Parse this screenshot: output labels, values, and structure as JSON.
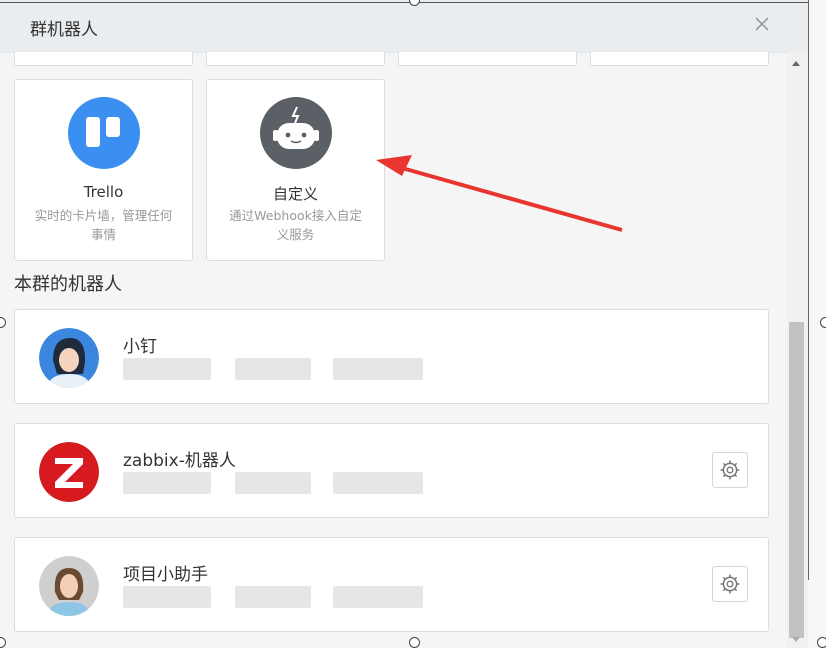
{
  "dialog": {
    "title": "群机器人"
  },
  "integrations": [
    {
      "name": "Trello",
      "desc": "实时的卡片墙，管理任何事情",
      "icon": "trello-icon",
      "color": "#3a8ff0"
    },
    {
      "name": "自定义",
      "desc": "通过Webhook接入自定义服务",
      "icon": "robot-icon",
      "color": "#5b6066"
    }
  ],
  "section": {
    "title": "本群的机器人"
  },
  "robots": [
    {
      "name": "小钉",
      "avatar": "avatar-girl-icon",
      "has_settings": false
    },
    {
      "name": "zabbix-机器人",
      "avatar": "zabbix-logo-icon",
      "has_settings": true
    },
    {
      "name": "项目小助手",
      "avatar": "avatar-woman-icon",
      "has_settings": true
    }
  ],
  "colors": {
    "arrow": "#e8362f",
    "header_bg": "#eaedf0",
    "page_bg": "#f5f5f5"
  }
}
